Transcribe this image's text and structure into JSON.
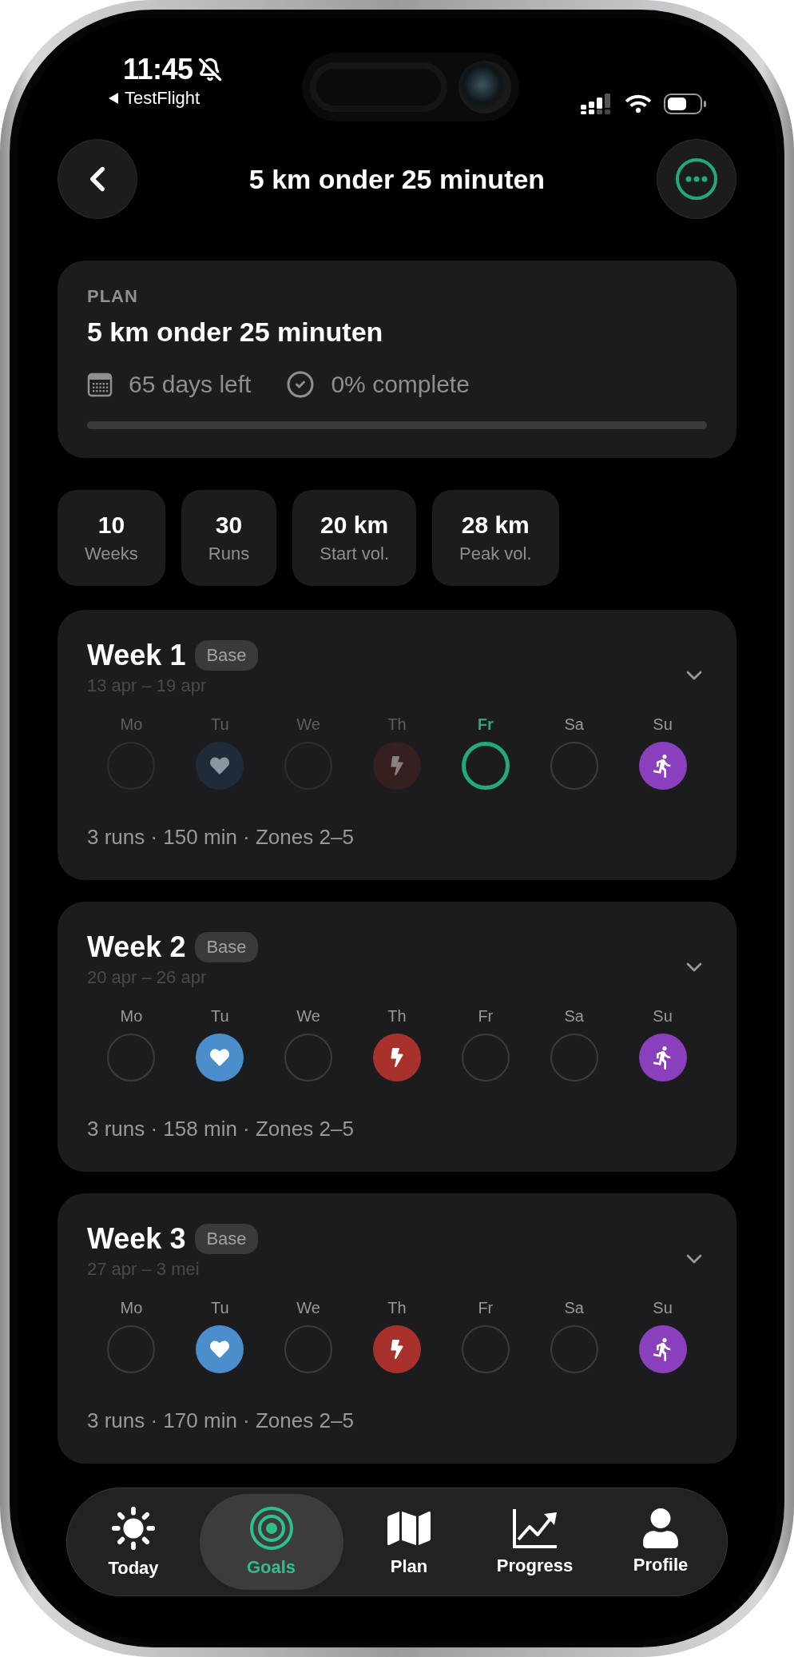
{
  "status_bar": {
    "time": "11:45",
    "back_app": "TestFlight"
  },
  "header": {
    "title": "5 km onder 25 minuten"
  },
  "plan": {
    "eyebrow": "PLAN",
    "title": "5 km onder 25 minuten",
    "days_left": "65 days left",
    "complete": "0% complete",
    "level": 0
  },
  "stats": [
    {
      "value": "10",
      "label": "Weeks"
    },
    {
      "value": "30",
      "label": "Runs"
    },
    {
      "value": "20 km",
      "label": "Start vol."
    },
    {
      "value": "28 km",
      "label": "Peak vol."
    }
  ],
  "weeks": [
    {
      "title": "Week 1",
      "phase": "Base",
      "dates": "13 apr – 19 apr",
      "summary": "3 runs · 150 min · Zones 2–5",
      "days": [
        {
          "label": "Mo",
          "kind": "rest",
          "past": true,
          "today": false
        },
        {
          "label": "Tu",
          "kind": "easy",
          "past": true,
          "today": false
        },
        {
          "label": "We",
          "kind": "rest",
          "past": true,
          "today": false
        },
        {
          "label": "Th",
          "kind": "interval",
          "past": true,
          "today": false
        },
        {
          "label": "Fr",
          "kind": "rest",
          "past": false,
          "today": true
        },
        {
          "label": "Sa",
          "kind": "rest",
          "past": false,
          "today": false
        },
        {
          "label": "Su",
          "kind": "long",
          "past": false,
          "today": false
        }
      ]
    },
    {
      "title": "Week 2",
      "phase": "Base",
      "dates": "20 apr – 26 apr",
      "summary": "3 runs · 158 min · Zones 2–5",
      "days": [
        {
          "label": "Mo",
          "kind": "rest",
          "past": false,
          "today": false
        },
        {
          "label": "Tu",
          "kind": "easy",
          "past": false,
          "today": false
        },
        {
          "label": "We",
          "kind": "rest",
          "past": false,
          "today": false
        },
        {
          "label": "Th",
          "kind": "interval",
          "past": false,
          "today": false
        },
        {
          "label": "Fr",
          "kind": "rest",
          "past": false,
          "today": false
        },
        {
          "label": "Sa",
          "kind": "rest",
          "past": false,
          "today": false
        },
        {
          "label": "Su",
          "kind": "long",
          "past": false,
          "today": false
        }
      ]
    },
    {
      "title": "Week 3",
      "phase": "Base",
      "dates": "27 apr – 3 mei",
      "summary": "3 runs · 170 min · Zones 2–5",
      "days": [
        {
          "label": "Mo",
          "kind": "rest",
          "past": false,
          "today": false
        },
        {
          "label": "Tu",
          "kind": "easy",
          "past": false,
          "today": false
        },
        {
          "label": "We",
          "kind": "rest",
          "past": false,
          "today": false
        },
        {
          "label": "Th",
          "kind": "interval",
          "past": false,
          "today": false
        },
        {
          "label": "Fr",
          "kind": "rest",
          "past": false,
          "today": false
        },
        {
          "label": "Sa",
          "kind": "rest",
          "past": false,
          "today": false
        },
        {
          "label": "Su",
          "kind": "long",
          "past": false,
          "today": false
        }
      ]
    }
  ],
  "tab_bar": [
    {
      "label": "Today",
      "kind": "today",
      "selected": false
    },
    {
      "label": "Goals",
      "kind": "goals",
      "selected": true
    },
    {
      "label": "Plan",
      "kind": "plan",
      "selected": false
    },
    {
      "label": "Progress",
      "kind": "progress",
      "selected": false
    },
    {
      "label": "Profile",
      "kind": "profile",
      "selected": false
    }
  ]
}
